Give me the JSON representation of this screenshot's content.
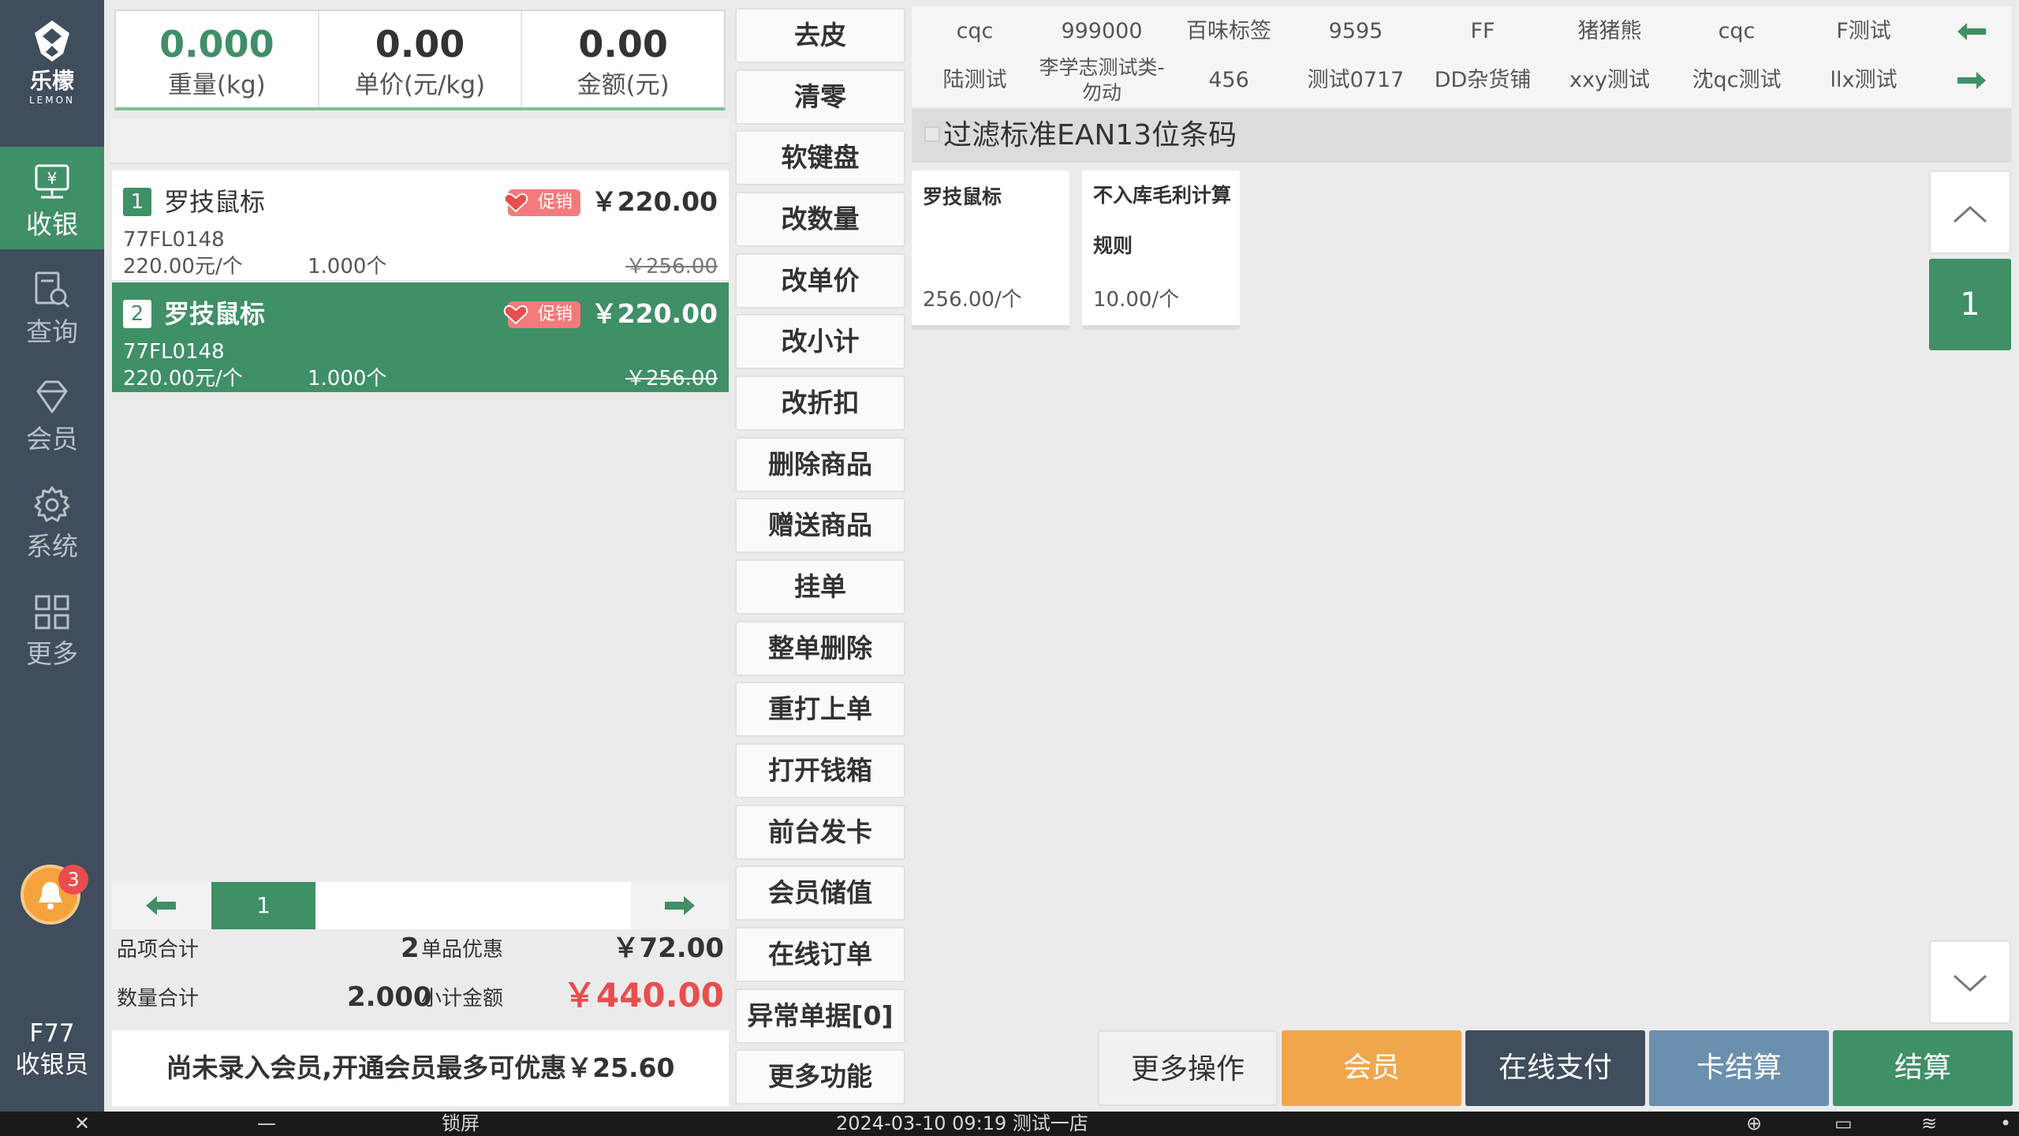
{
  "brand": {
    "name_cn": "乐檬",
    "name_en": "LEMON"
  },
  "sidebar": {
    "items": [
      {
        "label": "收银",
        "icon": "cashier-icon",
        "active": true
      },
      {
        "label": "查询",
        "icon": "search-doc-icon"
      },
      {
        "label": "会员",
        "icon": "diamond-icon"
      },
      {
        "label": "系统",
        "icon": "gear-icon"
      },
      {
        "label": "更多",
        "icon": "grid-icon"
      }
    ],
    "notification_count": "3",
    "terminal": "F77",
    "role": "收银员"
  },
  "scale": {
    "weight": "0.000",
    "weight_label": "重量(kg)",
    "unit_price": "0.00",
    "unit_price_label": "单价(元/kg)",
    "amount": "0.00",
    "amount_label": "金额(元)"
  },
  "cart": {
    "items": [
      {
        "index": "1",
        "name": "罗技鼠标",
        "promo": "促销",
        "price": "￥220.00",
        "code": "77FL0148",
        "unit_price": "220.00元/个",
        "qty": "1.000个",
        "orig_price": "￥256.00"
      },
      {
        "index": "2",
        "name": "罗技鼠标",
        "promo": "促销",
        "price": "￥220.00",
        "code": "77FL0148",
        "unit_price": "220.00元/个",
        "qty": "1.000个",
        "orig_price": "￥256.00"
      }
    ],
    "page": "1"
  },
  "totals": {
    "item_count_label": "品项合计",
    "item_count": "2",
    "discount_label": "单品优惠",
    "discount": "￥72.00",
    "qty_label": "数量合计",
    "qty": "2.000",
    "subtotal_label": "小计金额",
    "subtotal": "￥440.00"
  },
  "member_hint": "尚未录入会员,开通会员最多可优惠￥25.60",
  "functions": [
    "去皮",
    "清零",
    "软键盘",
    "改数量",
    "改单价",
    "改小计",
    "改折扣",
    "删除商品",
    "赠送商品",
    "挂单",
    "整单删除",
    "重打上单",
    "打开钱箱",
    "前台发卡",
    "会员储值",
    "在线订单",
    "异常单据[0]",
    "更多功能"
  ],
  "categories": {
    "row1": [
      "cqc",
      "999000",
      "百味标签",
      "9595",
      "FF",
      "猪猪熊",
      "cqc",
      "F测试"
    ],
    "row2": [
      "陆测试",
      "李学志测试类-勿动",
      "456",
      "测试0717",
      "DD杂货铺",
      "xxy测试",
      "沈qc测试",
      "llx测试"
    ]
  },
  "filter": {
    "label": "过滤标准EAN13位条码",
    "checked": false
  },
  "products": [
    {
      "name": "罗技鼠标",
      "price": "256.00/个"
    },
    {
      "name": "不入库毛利计算规则",
      "price": "10.00/个"
    }
  ],
  "product_page": "1",
  "actions": {
    "more": "更多操作",
    "member": "会员",
    "online_pay": "在线支付",
    "card_settle": "卡结算",
    "settle": "结算"
  },
  "taskbar": {
    "lock": "锁屏",
    "datetime_store": "2024-03-10 09:19 测试一店"
  },
  "colors": {
    "primary_green": "#3f8f67",
    "sidebar": "#3f4d5c",
    "accent_orange": "#f0a74c",
    "price_red": "#e94d4d"
  }
}
